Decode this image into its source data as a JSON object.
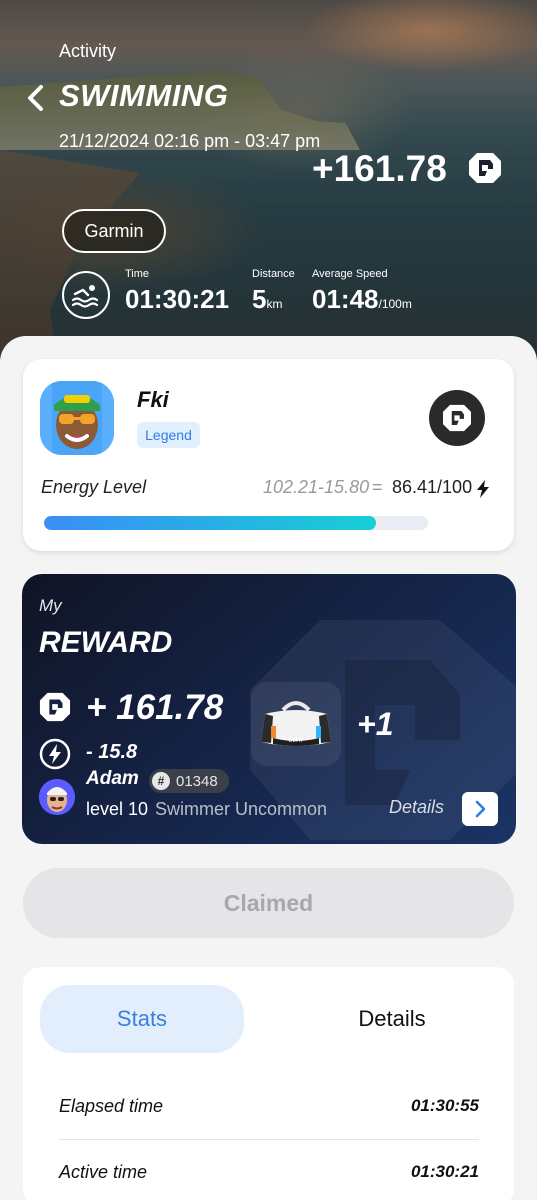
{
  "header": {
    "activity_label": "Activity",
    "title": "SWIMMING",
    "datetime": "21/12/2024 02:16 pm - 03:47 pm",
    "reward": "+161.78",
    "device": "Garmin",
    "stats": [
      {
        "label": "Time",
        "value": "01:30:21",
        "unit": ""
      },
      {
        "label": "Distance",
        "value": "5",
        "unit": "km"
      },
      {
        "label": "Average Speed",
        "value": "01:48",
        "unit": "/100m"
      }
    ]
  },
  "profile": {
    "name": "Fki",
    "badge": "Legend",
    "energy_label": "Energy Level",
    "energy_formula": "102.21-15.80",
    "energy_equals": "=",
    "energy_value": "86.41/100",
    "energy_fraction": 0.8641
  },
  "reward": {
    "my_label": "My",
    "title": "REWARD",
    "amount": "+ 161.78",
    "energy_change": "- 15.8",
    "item_count": "+1",
    "user": {
      "name": "Adam",
      "id_hash": "#",
      "id": "01348",
      "level": "level 10",
      "rank": "Swimmer Uncommon"
    },
    "details_label": "Details"
  },
  "claim_button": "Claimed",
  "tabs": [
    {
      "label": "Stats",
      "active": true
    },
    {
      "label": "Details",
      "active": false
    }
  ],
  "stats_rows": [
    {
      "label": "Elapsed time",
      "value": "01:30:55"
    },
    {
      "label": "Active time",
      "value": "01:30:21"
    }
  ],
  "colors": {
    "accent_blue": "#3a7fd9",
    "energy_gradient_start": "#3b8df5",
    "energy_gradient_end": "#16cfd6",
    "reward_card_bg": "#152244"
  },
  "icons": [
    "back-arrow-icon",
    "defit-coin-icon",
    "swim-icon",
    "bolt-icon",
    "gym-bag-icon",
    "chevron-right-icon"
  ]
}
